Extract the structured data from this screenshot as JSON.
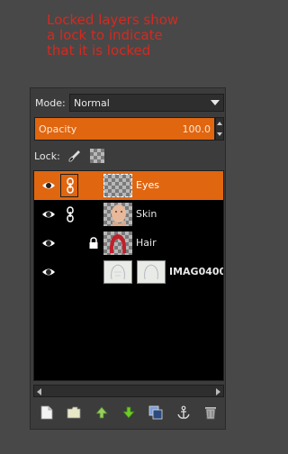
{
  "annotation": {
    "line1": "Locked layers show",
    "line2": "a lock to indicate",
    "line3": "that it is locked"
  },
  "colors": {
    "accent": "#e06610",
    "annotation_text": "#d42a20",
    "panel_bg": "#3c3c3c",
    "list_bg": "#000000"
  },
  "mode": {
    "label": "Mode:",
    "value": "Normal"
  },
  "opacity": {
    "label": "Opacity",
    "value": "100.0"
  },
  "lock": {
    "label": "Lock:",
    "icons": [
      "paintbrush-icon",
      "alpha-checker-icon"
    ]
  },
  "layers": [
    {
      "name": "Eyes",
      "visible": true,
      "linked": true,
      "locked": false,
      "selected": true
    },
    {
      "name": "Skin",
      "visible": true,
      "linked": true,
      "locked": false,
      "selected": false
    },
    {
      "name": "Hair",
      "visible": true,
      "linked": false,
      "locked": true,
      "selected": false
    },
    {
      "name": "IMAG0400",
      "visible": true,
      "linked": false,
      "locked": false,
      "selected": false,
      "has_mask": true
    }
  ],
  "toolbar": [
    "new-layer-icon",
    "layer-group-icon",
    "raise-layer-icon",
    "lower-layer-icon",
    "duplicate-layer-icon",
    "anchor-layer-icon",
    "delete-layer-icon"
  ]
}
